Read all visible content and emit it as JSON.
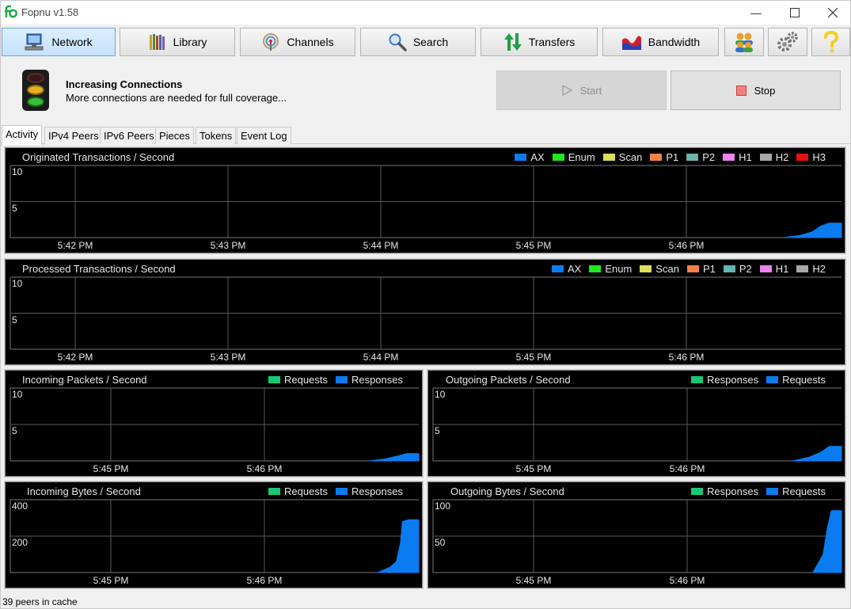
{
  "window": {
    "title": "Fopnu v1.58"
  },
  "toolbar": {
    "buttons": [
      {
        "label": "Network",
        "icon": "network-computer-icon",
        "active": true
      },
      {
        "label": "Library",
        "icon": "library-books-icon"
      },
      {
        "label": "Channels",
        "icon": "channels-antenna-icon"
      },
      {
        "label": "Search",
        "icon": "search-magnifier-icon"
      },
      {
        "label": "Transfers",
        "icon": "transfers-arrows-icon"
      },
      {
        "label": "Bandwidth",
        "icon": "bandwidth-chart-icon"
      }
    ],
    "icon_buttons": [
      "users-icon",
      "settings-gears-icon",
      "help-icon"
    ]
  },
  "status": {
    "heading": "Increasing Connections",
    "message": "More connections are needed for full coverage...",
    "start_label": "Start",
    "stop_label": "Stop"
  },
  "tabs": [
    "Activity",
    "IPv4 Peers",
    "IPv6 Peers",
    "Pieces",
    "Tokens",
    "Event Log"
  ],
  "status_bar": "39 peers in cache",
  "colors": {
    "AX": "#0a7cf0",
    "Enum": "#1ee81e",
    "Scan": "#dede5a",
    "P1": "#f58148",
    "P2": "#69b4b0",
    "H1": "#ee82ee",
    "H2": "#a8a8a8",
    "H3": "#e81010",
    "Requests": "#18c878",
    "Responses": "#0a7cf0",
    "Requests_out": "#0a7cf0",
    "Responses_out": "#18c878"
  },
  "chart_data": [
    {
      "type": "area",
      "title": "Originated Transactions / Second",
      "series_names": [
        "AX",
        "Enum",
        "Scan",
        "P1",
        "P2",
        "H1",
        "H2",
        "H3"
      ],
      "yticks": [
        "10",
        "5"
      ],
      "ylim": [
        0,
        10
      ],
      "xticks": [
        "5:42 PM",
        "5:43 PM",
        "5:44 PM",
        "5:45 PM",
        "5:46 PM"
      ],
      "series": [
        {
          "name": "AX",
          "x": [
            0.93,
            0.95,
            0.965,
            0.975,
            0.985,
            1.0
          ],
          "y": [
            0,
            0.3,
            0.8,
            1.6,
            2.0,
            2.0
          ]
        }
      ]
    },
    {
      "type": "area",
      "title": "Processed Transactions / Second",
      "series_names": [
        "AX",
        "Enum",
        "Scan",
        "P1",
        "P2",
        "H1",
        "H2"
      ],
      "yticks": [
        "10",
        "5"
      ],
      "ylim": [
        0,
        10
      ],
      "xticks": [
        "5:42 PM",
        "5:43 PM",
        "5:44 PM",
        "5:45 PM",
        "5:46 PM"
      ],
      "series": []
    },
    {
      "type": "area",
      "title": "Incoming Packets / Second",
      "series_names": [
        "Requests",
        "Responses"
      ],
      "legend_colors": [
        "#18c878",
        "#0a7cf0"
      ],
      "yticks": [
        "10",
        "5"
      ],
      "ylim": [
        0,
        10
      ],
      "xticks": [
        "5:45 PM",
        "5:46 PM"
      ],
      "series": [
        {
          "name": "Responses",
          "x": [
            0.88,
            0.92,
            0.95,
            0.97,
            1.0
          ],
          "y": [
            0,
            0.3,
            0.7,
            1.0,
            1.0
          ]
        }
      ]
    },
    {
      "type": "area",
      "title": "Outgoing Packets / Second",
      "series_names": [
        "Responses",
        "Requests"
      ],
      "legend_colors": [
        "#18c878",
        "#0a7cf0"
      ],
      "yticks": [
        "10",
        "5"
      ],
      "ylim": [
        0,
        10
      ],
      "xticks": [
        "5:45 PM",
        "5:46 PM"
      ],
      "series": [
        {
          "name": "Requests",
          "x": [
            0.88,
            0.92,
            0.95,
            0.97,
            1.0
          ],
          "y": [
            0,
            0.5,
            1.2,
            2.0,
            2.0
          ]
        }
      ]
    },
    {
      "type": "area",
      "title": "Incoming Bytes / Second",
      "series_names": [
        "Requests",
        "Responses"
      ],
      "legend_colors": [
        "#18c878",
        "#0a7cf0"
      ],
      "yticks": [
        "400",
        "200"
      ],
      "ylim": [
        0,
        400
      ],
      "xticks": [
        "5:45 PM",
        "5:46 PM"
      ],
      "series": [
        {
          "name": "Responses",
          "x": [
            0.9,
            0.93,
            0.945,
            0.955,
            0.96,
            0.975,
            1.0
          ],
          "y": [
            0,
            30,
            60,
            160,
            280,
            290,
            290
          ]
        }
      ]
    },
    {
      "type": "area",
      "title": "Outgoing Bytes / Second",
      "series_names": [
        "Responses",
        "Requests"
      ],
      "legend_colors": [
        "#18c878",
        "#0a7cf0"
      ],
      "yticks": [
        "100",
        "50"
      ],
      "ylim": [
        0,
        100
      ],
      "xticks": [
        "5:45 PM",
        "5:46 PM"
      ],
      "series": [
        {
          "name": "Requests",
          "x": [
            0.93,
            0.955,
            0.965,
            0.975,
            1.0
          ],
          "y": [
            0,
            25,
            60,
            85,
            85
          ]
        }
      ]
    }
  ]
}
